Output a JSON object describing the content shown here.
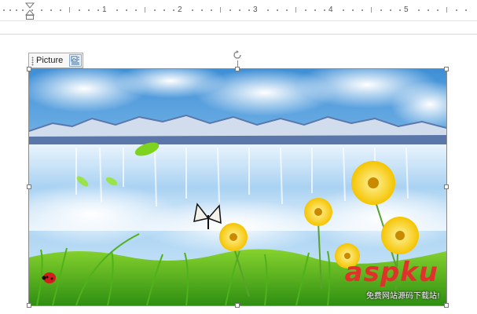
{
  "ruler": {
    "numbers": [
      "1",
      "2",
      "3",
      "4",
      "5"
    ]
  },
  "picture_tab": {
    "label": "Picture",
    "layout_icon": "layout-options-icon"
  },
  "image": {
    "description_icon": "inserted-picture",
    "watermark_text": "aspku",
    "watermark_sub": "免费网站源码下载站!"
  },
  "colors": {
    "handle_border": "#7a7a7a",
    "frame_outline": "#8a8a8a",
    "watermark": "#e0322b"
  }
}
